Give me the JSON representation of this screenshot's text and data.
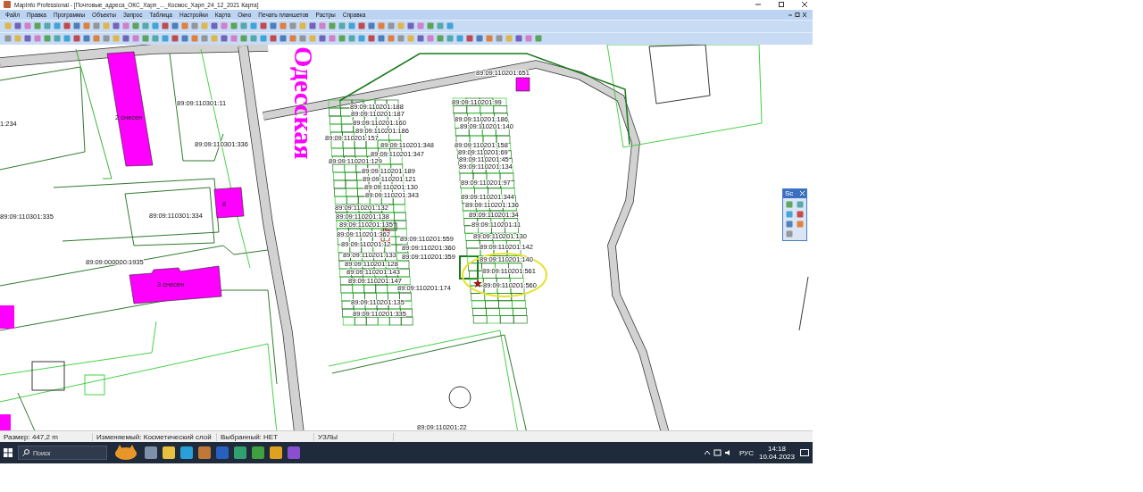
{
  "window": {
    "title": "MapInfo Professional - [Почтовые_адреса_ОКС_Харп_..._Космос_Харп_24_12_2021 Карта]"
  },
  "menu": [
    "Файл",
    "Правка",
    "Программы",
    "Объекты",
    "Запрос",
    "Таблица",
    "Настройки",
    "Карта",
    "Окно",
    "Печать планшетов",
    "Растры",
    "Справка"
  ],
  "map": {
    "street_label": "Одесская",
    "building_labels": [
      "2 снесен",
      "8",
      "3 снесен"
    ],
    "parcel_labels": [
      "1:234",
      "89:09:110301:11",
      "89:09:110301:336",
      "89:09:110301:335",
      "89:09:110301:334",
      "89:09:000000:1935",
      "89:09:110201:651",
      "89:09:110201:188",
      "89:09:110201:187",
      "89:09:110201:160",
      "89:09:110201:186",
      "89:09:110201:157",
      "89:09:110201:348",
      "89:09:110201:347",
      "89:09:110201:129",
      "89:09:110201:189",
      "89:09:110201:121",
      "89:09:110201:130",
      "89:09:110201:343",
      "89:09:110201:132",
      "89:09:110201:138",
      "89:09:110201:135",
      "89:09:110201:362",
      "89:09:110201:12",
      "89:09:110201:133",
      "89:09:110201:128",
      "89:09:110201:143",
      "89:09:110201:147",
      "89:09:110201:135",
      "89:09:110201:335",
      "89:09:110201:559",
      "89:09:110201:360",
      "89:09:110201:359",
      "89:09:110201:174",
      "89:09:110201:99",
      "89:09:110201:186",
      "89:09:110201:140",
      "89:09:110201:158",
      "89:09:110201:69",
      "89:09:110201:45",
      "89:09:110201:134",
      "89:09:110201:97",
      "89:09:110201:344",
      "89:09:110201:136",
      "89:09:110201:34",
      "89:09:110201:11",
      "89:09:110201:130",
      "89:09:110201:142",
      "89:09:110201:140",
      "89:09:110201:561",
      "89:09:110201:560",
      "89:09:110201:22"
    ],
    "floating_toolbar": {
      "title": "Sc"
    }
  },
  "status_bar": [
    "Размер: 447,2 m",
    "Изменяемый: Косметический слой",
    "Выбранный: НЕТ",
    "УЗЛЫ"
  ],
  "taskbar": {
    "search_placeholder": "Поиск",
    "language": "РУС",
    "time": "14:18",
    "date": "10.04.2023"
  }
}
